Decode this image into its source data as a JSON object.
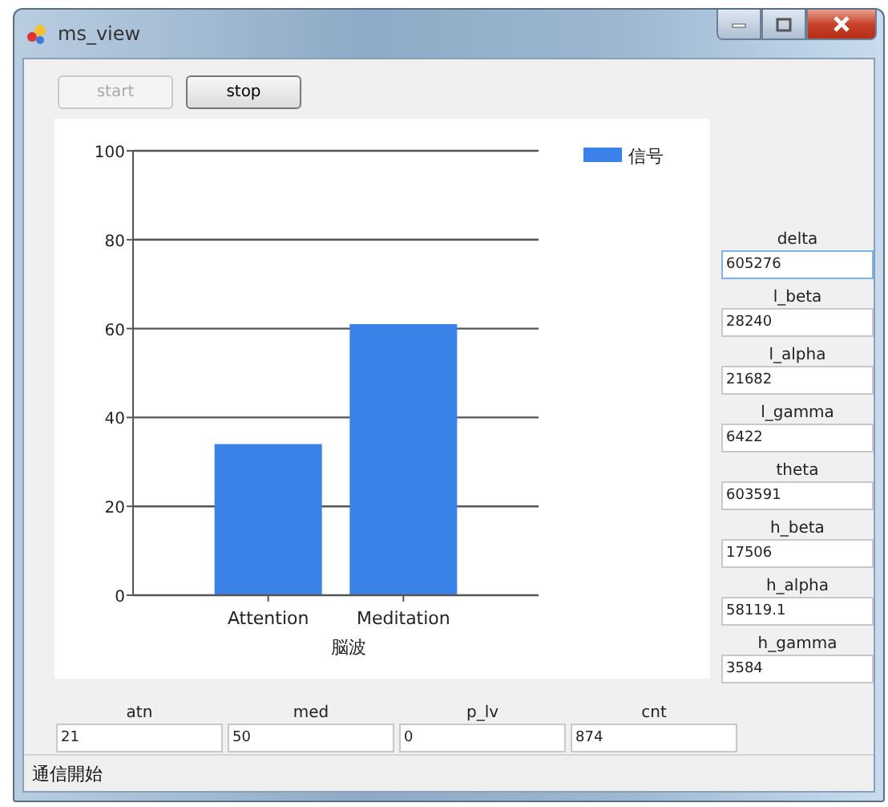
{
  "window": {
    "title": "ms_view"
  },
  "buttons": [
    {
      "label": "start",
      "disabled": true
    },
    {
      "label": "stop",
      "disabled": false
    }
  ],
  "chart_data": {
    "type": "bar",
    "xlabel": "脳波",
    "categories": [
      "Attention",
      "Meditation"
    ],
    "series": [
      {
        "name": "信号",
        "color": "#3b82e8",
        "values": [
          34,
          61
        ]
      }
    ],
    "ylim": [
      0,
      100
    ],
    "grid": true,
    "yticks": [
      0,
      20,
      40,
      60,
      80,
      100
    ]
  },
  "side_fields": [
    {
      "label": "delta",
      "value": "605276"
    },
    {
      "label": "l_beta",
      "value": "28240"
    },
    {
      "label": "l_alpha",
      "value": "21682"
    },
    {
      "label": "l_gamma",
      "value": "6422"
    },
    {
      "label": "theta",
      "value": "603591"
    },
    {
      "label": "h_beta",
      "value": "17506"
    },
    {
      "label": "h_alpha",
      "value": "58119.1"
    },
    {
      "label": "h_gamma",
      "value": "3584"
    }
  ],
  "bottom_fields": [
    {
      "label": "atn",
      "value": "21"
    },
    {
      "label": "med",
      "value": "50"
    },
    {
      "label": "p_lv",
      "value": "0"
    },
    {
      "label": "cnt",
      "value": "874"
    }
  ],
  "status_bar": "通信開始"
}
